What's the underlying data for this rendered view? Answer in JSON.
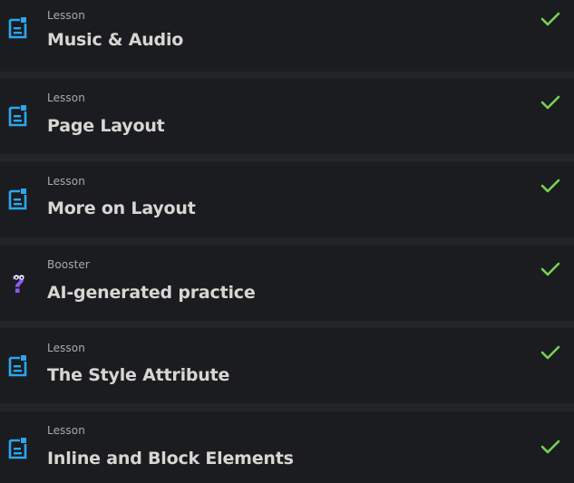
{
  "lessons": [
    {
      "type": "Lesson",
      "title": "Music & Audio",
      "icon": "lesson-document-icon",
      "completed": true
    },
    {
      "type": "Lesson",
      "title": "Page Layout",
      "icon": "lesson-document-icon",
      "completed": true
    },
    {
      "type": "Lesson",
      "title": "More on Layout",
      "icon": "lesson-document-icon",
      "completed": true
    },
    {
      "type": "Booster",
      "title": "AI-generated practice",
      "icon": "booster-question-icon",
      "completed": true
    },
    {
      "type": "Lesson",
      "title": "The Style Attribute",
      "icon": "lesson-document-icon",
      "completed": true
    },
    {
      "type": "Lesson",
      "title": "Inline and Block Elements",
      "icon": "lesson-document-icon",
      "completed": true
    }
  ],
  "colors": {
    "lesson_icon": "#2aa7f0",
    "booster_icon": "#8a5cf6",
    "check": "#77d355",
    "item_background": "#1b1c1f",
    "page_background": "#232427"
  }
}
